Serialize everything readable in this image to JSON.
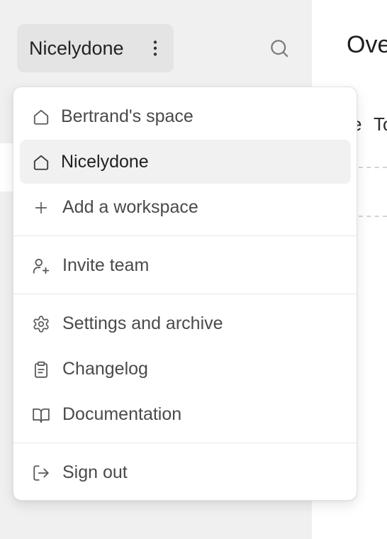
{
  "sidebar": {
    "workspace_name": "Nicelydone"
  },
  "main": {
    "title": "Ove",
    "tab_partial_1": "e",
    "tab_partial_2": "To"
  },
  "menu": {
    "workspaces": [
      {
        "label": "Bertrand's space",
        "icon": "home-icon",
        "active": false
      },
      {
        "label": "Nicelydone",
        "icon": "home-icon",
        "active": true
      }
    ],
    "add_workspace": {
      "label": "Add a workspace",
      "icon": "plus-icon"
    },
    "invite": {
      "label": "Invite team",
      "icon": "user-plus-icon"
    },
    "settings": {
      "label": "Settings and archive",
      "icon": "gear-icon"
    },
    "changelog": {
      "label": "Changelog",
      "icon": "clipboard-icon"
    },
    "documentation": {
      "label": "Documentation",
      "icon": "book-open-icon"
    },
    "sign_out": {
      "label": "Sign out",
      "icon": "log-out-icon"
    }
  },
  "colors": {
    "sidebar_bg": "#f0f0f0",
    "switcher_bg": "#e4e4e4",
    "active_item_bg": "#f1f1f1",
    "menu_text": "#4a4a4a",
    "icon_stroke": "#5a5a5a"
  }
}
